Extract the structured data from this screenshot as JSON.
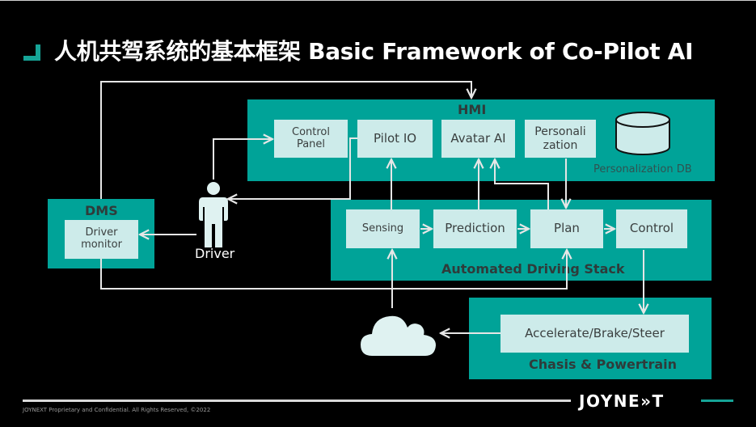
{
  "title": "人机共驾系统的基本框架 Basic Framework of Co-Pilot AI",
  "hmi": {
    "label": "HMI",
    "boxes": [
      {
        "id": "control-panel",
        "label": "Control\nPanel"
      },
      {
        "id": "pilot-io",
        "label": "Pilot IO"
      },
      {
        "id": "avatar-ai",
        "label": "Avatar AI"
      },
      {
        "id": "personalization",
        "label": "Personali\nzation"
      }
    ],
    "db_icon": "database-cylinder-icon",
    "db_label": "Personalization DB"
  },
  "dms": {
    "label": "DMS",
    "box": "Driver\nmonitor"
  },
  "driver": {
    "icon": "person-icon",
    "label": "Driver"
  },
  "ads": {
    "label": "Automated Driving Stack",
    "boxes": [
      {
        "id": "sensing",
        "label": "Sensing"
      },
      {
        "id": "prediction",
        "label": "Prediction"
      },
      {
        "id": "plan",
        "label": "Plan"
      },
      {
        "id": "control",
        "label": "Control"
      }
    ]
  },
  "chassis": {
    "label": "Chasis & Powertrain",
    "box": "Accelerate/Brake/Steer"
  },
  "cloud": {
    "icon": "cloud-icon"
  },
  "colors": {
    "panel": "#00a398",
    "box": "#cdebea",
    "accent": "#16a497",
    "wire": "#e6e6e6",
    "background": "#000000"
  },
  "footer": {
    "text": "JOYNEXT Proprietary and Confidential. All Rights Reserved, ©2022",
    "logo": "JOYNE»T"
  }
}
